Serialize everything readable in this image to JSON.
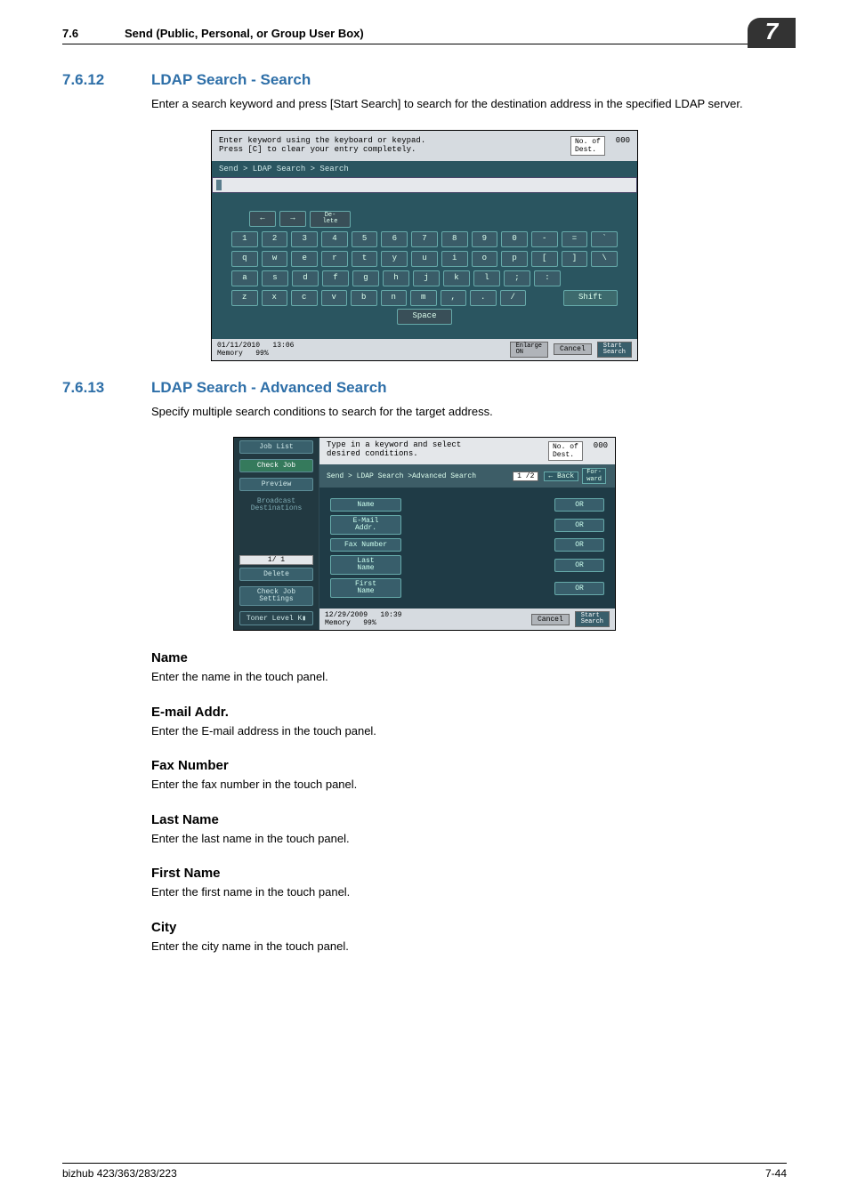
{
  "header": {
    "section_number": "7.6",
    "section_title": "Send (Public, Personal, or Group User Box)",
    "chapter_badge": "7"
  },
  "footer": {
    "model": "bizhub 423/363/283/223",
    "pageno": "7-44"
  },
  "s7612": {
    "number": "7.6.12",
    "title": "LDAP Search - Search",
    "para": "Enter a search keyword and press [Start Search] to search for the destination address in the specified LDAP server."
  },
  "s7613": {
    "number": "7.6.13",
    "title": "LDAP Search - Advanced Search",
    "para": "Specify multiple search conditions to search for the target address."
  },
  "screen1": {
    "prompt_l1": "Enter keyword using the keyboard or keypad.",
    "prompt_l2": "Press [C] to clear your entry completely.",
    "dest_label": "No. of\nDest.",
    "dest_count": "000",
    "breadcrumb": "Send > LDAP Search > Search",
    "util": {
      "left": "←",
      "right": "→",
      "delete": "De-\nlete"
    },
    "row1": [
      "1",
      "2",
      "3",
      "4",
      "5",
      "6",
      "7",
      "8",
      "9",
      "0",
      "-",
      "=",
      "`"
    ],
    "row2": [
      "q",
      "w",
      "e",
      "r",
      "t",
      "y",
      "u",
      "i",
      "o",
      "p",
      "[",
      "]",
      "\\"
    ],
    "row3": [
      "a",
      "s",
      "d",
      "f",
      "g",
      "h",
      "j",
      "k",
      "l",
      ";",
      ":"
    ],
    "row4": [
      "z",
      "x",
      "c",
      "v",
      "b",
      "n",
      "m",
      ",",
      ".",
      "/"
    ],
    "shift": "Shift",
    "space": "Space",
    "bottom": {
      "date": "01/11/2010",
      "time": "13:06",
      "mem_label": "Memory",
      "mem": "99%",
      "enlarge": "Enlarge\nON",
      "cancel": "Cancel",
      "start": "Start\nSearch"
    }
  },
  "screen2": {
    "left": {
      "joblist": "Job List",
      "checkjob": "Check Job",
      "preview": "Preview",
      "broadcast": "Broadcast\nDestinations",
      "page": "1/  1",
      "delete": "Delete",
      "checksettings": "Check Job\nSettings",
      "toner": "Toner Level  K▮"
    },
    "top": {
      "l1": "Type in a keyword and select",
      "l2": "desired conditions.",
      "dest_label": "No. of\nDest.",
      "dest_count": "000"
    },
    "crumb": {
      "text": "Send > LDAP Search >Advanced Search",
      "page": "1 /2",
      "back": "Back",
      "fwd": "For-\nward"
    },
    "fields": {
      "name": "Name",
      "email": "E-Mail\nAddr.",
      "fax": "Fax Number",
      "last": "Last\nName",
      "first": "First\nName",
      "or": "OR"
    },
    "bottom": {
      "date": "12/29/2009",
      "time": "10:39",
      "mem_label": "Memory",
      "mem": "99%",
      "cancel": "Cancel",
      "start": "Start\nSearch"
    }
  },
  "defs": {
    "name_h": "Name",
    "name_p": "Enter the name in the touch panel.",
    "email_h": "E-mail Addr.",
    "email_p": "Enter the E-mail address in the touch panel.",
    "fax_h": "Fax Number",
    "fax_p": "Enter the fax number in the touch panel.",
    "last_h": "Last Name",
    "last_p": "Enter the last name in the touch panel.",
    "first_h": "First Name",
    "first_p": "Enter the first name in the touch panel.",
    "city_h": "City",
    "city_p": "Enter the city name in the touch panel."
  }
}
